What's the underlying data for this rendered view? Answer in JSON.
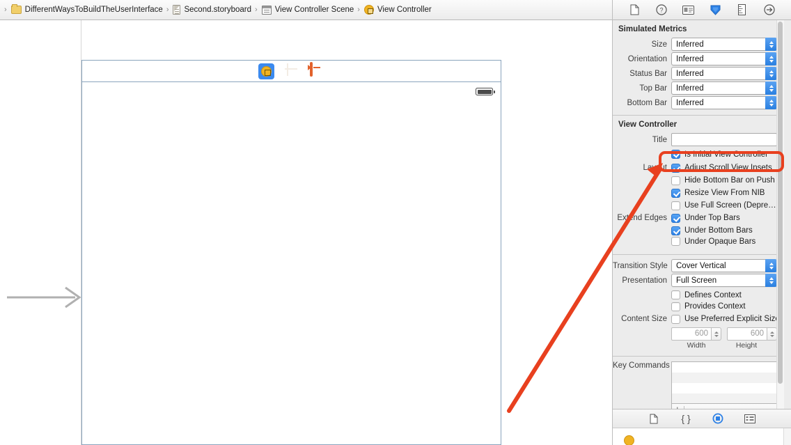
{
  "breadcrumb": {
    "items": [
      {
        "label": "DifferentWaysToBuildTheUserInterface",
        "icon": "folder-icon"
      },
      {
        "label": "Second.storyboard",
        "icon": "document-icon"
      },
      {
        "label": "View Controller Scene",
        "icon": "scene-icon"
      },
      {
        "label": "View Controller",
        "icon": "view-controller-icon"
      }
    ],
    "separator": "›"
  },
  "canvas": {
    "dock": [
      {
        "name": "view-controller-dock-icon",
        "selected": true
      },
      {
        "name": "first-responder-dock-icon",
        "selected": false
      },
      {
        "name": "exit-dock-icon",
        "selected": false
      }
    ],
    "status_bar": {
      "battery": "battery-icon"
    },
    "initial_arrow": "initial-view-controller-arrow"
  },
  "inspector": {
    "tabs": [
      {
        "name": "file-inspector-tab",
        "icon": "document-icon",
        "selected": false
      },
      {
        "name": "quick-help-inspector-tab",
        "icon": "question-circle-icon",
        "selected": false
      },
      {
        "name": "identity-inspector-tab",
        "icon": "identity-card-icon",
        "selected": false
      },
      {
        "name": "attributes-inspector-tab",
        "icon": "attributes-shield-icon",
        "selected": true
      },
      {
        "name": "size-inspector-tab",
        "icon": "ruler-icon",
        "selected": false
      },
      {
        "name": "connections-inspector-tab",
        "icon": "arrow-circle-icon",
        "selected": false
      }
    ],
    "simulated_metrics": {
      "title": "Simulated Metrics",
      "rows": [
        {
          "label": "Size",
          "value": "Inferred"
        },
        {
          "label": "Orientation",
          "value": "Inferred"
        },
        {
          "label": "Status Bar",
          "value": "Inferred"
        },
        {
          "label": "Top Bar",
          "value": "Inferred"
        },
        {
          "label": "Bottom Bar",
          "value": "Inferred"
        }
      ]
    },
    "view_controller": {
      "title": "View Controller",
      "title_field": {
        "label": "Title",
        "value": "",
        "placeholder": ""
      },
      "is_initial": {
        "label": "Is Initial View Controller",
        "checked": true
      },
      "layout": {
        "label": "Layout",
        "items": [
          {
            "label": "Adjust Scroll View Insets",
            "checked": true
          },
          {
            "label": "Hide Bottom Bar on Push",
            "checked": false
          },
          {
            "label": "Resize View From NIB",
            "checked": true
          },
          {
            "label": "Use Full Screen (Depre…",
            "checked": false
          }
        ]
      },
      "extend_edges": {
        "label": "Extend Edges",
        "items": [
          {
            "label": "Under Top Bars",
            "checked": true
          },
          {
            "label": "Under Bottom Bars",
            "checked": true
          },
          {
            "label": "Under Opaque Bars",
            "checked": false
          }
        ]
      },
      "transition_style": {
        "label": "Transition Style",
        "value": "Cover Vertical"
      },
      "presentation": {
        "label": "Presentation",
        "value": "Full Screen"
      },
      "context": [
        {
          "label": "Defines Context",
          "checked": false
        },
        {
          "label": "Provides Context",
          "checked": false
        }
      ],
      "content_size": {
        "label": "Content Size",
        "checkbox": {
          "label": "Use Preferred Explicit Size",
          "checked": false
        },
        "width": {
          "value": "600",
          "caption": "Width"
        },
        "height": {
          "value": "600",
          "caption": "Height"
        }
      },
      "key_commands": {
        "label": "Key Commands",
        "items": [],
        "add_label": "+",
        "remove_label": "−"
      }
    }
  },
  "library": {
    "tabs": [
      {
        "name": "file-template-library-tab",
        "icon": "document-icon",
        "selected": false
      },
      {
        "name": "code-snippet-library-tab",
        "icon": "braces-icon",
        "selected": false
      },
      {
        "name": "object-library-tab",
        "icon": "circle-target-icon",
        "selected": true
      },
      {
        "name": "media-library-tab",
        "icon": "media-grid-icon",
        "selected": false
      }
    ]
  },
  "annotation": {
    "highlight_color": "#e8401f",
    "target": "is-initial-view-controller-checkbox"
  }
}
